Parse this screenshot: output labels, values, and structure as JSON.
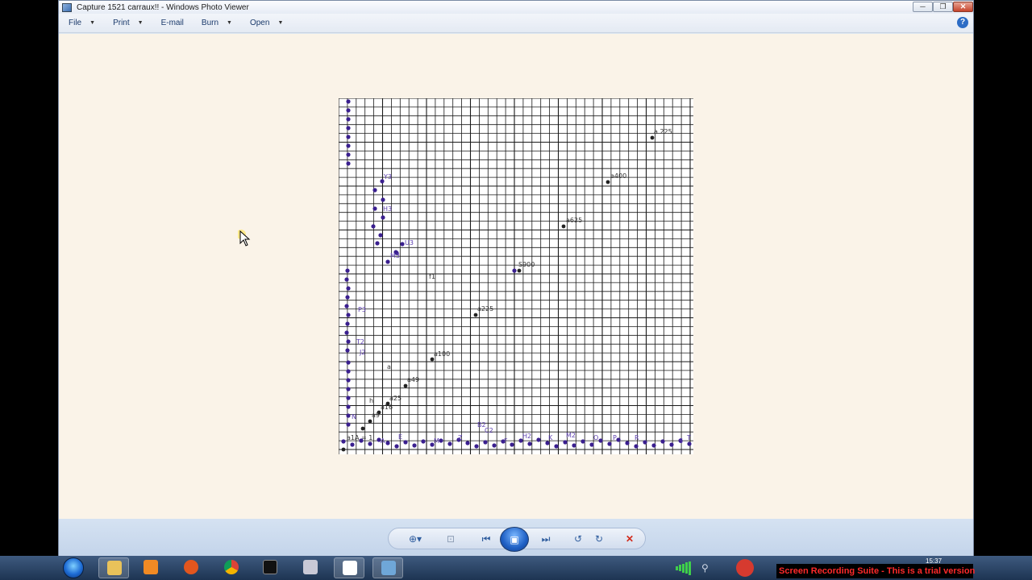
{
  "window": {
    "title": "Capture 1521 carraux!! - Windows Photo Viewer",
    "min_glyph": "─",
    "max_glyph": "❐",
    "close_glyph": "✕"
  },
  "menu": {
    "items": [
      {
        "label": "File"
      },
      {
        "label": "Print"
      },
      {
        "label": "E-mail"
      },
      {
        "label": "Burn"
      },
      {
        "label": "Open"
      }
    ],
    "help_glyph": "?"
  },
  "plot": {
    "labels": [
      {
        "text": "a 225"
      },
      {
        "text": "a400"
      },
      {
        "text": "a625"
      },
      {
        "text": "S900"
      },
      {
        "text": "a225"
      },
      {
        "text": "a100"
      },
      {
        "text": "a49"
      },
      {
        "text": "a25"
      },
      {
        "text": "a16"
      },
      {
        "text": "a9"
      },
      {
        "text": "h"
      },
      {
        "text": "f1"
      },
      {
        "text": "a"
      },
      {
        "text": "a1A = 1"
      },
      {
        "text": "M3"
      },
      {
        "text": "U3"
      },
      {
        "text": "H3"
      },
      {
        "text": "Y3"
      },
      {
        "text": "P3"
      },
      {
        "text": "T2"
      },
      {
        "text": "J2"
      },
      {
        "text": "N"
      },
      {
        "text": "A"
      },
      {
        "text": "E"
      },
      {
        "text": "M"
      },
      {
        "text": "Z"
      },
      {
        "text": "B2"
      },
      {
        "text": "C2"
      },
      {
        "text": "F"
      },
      {
        "text": "H2"
      },
      {
        "text": "K"
      },
      {
        "text": "M2"
      },
      {
        "text": "O"
      },
      {
        "text": "P"
      },
      {
        "text": "R"
      },
      {
        "text": "T"
      },
      {
        "text": "S"
      }
    ],
    "colors": {
      "grid": "#1a1a1a",
      "point": "#3a1f8f",
      "label": "#5c3fb0",
      "black_point": "#222222"
    }
  },
  "controls": {
    "zoom": "⊕▾",
    "actual_size": "⊡",
    "prev": "⏮",
    "slideshow": "▣",
    "next": "⏭",
    "rotate_left": "↺",
    "rotate_right": "↻",
    "delete": "✕"
  },
  "taskbar": {
    "recording_banner": "Screen Recording Suite - This is a trial version",
    "clock": "15:37"
  }
}
